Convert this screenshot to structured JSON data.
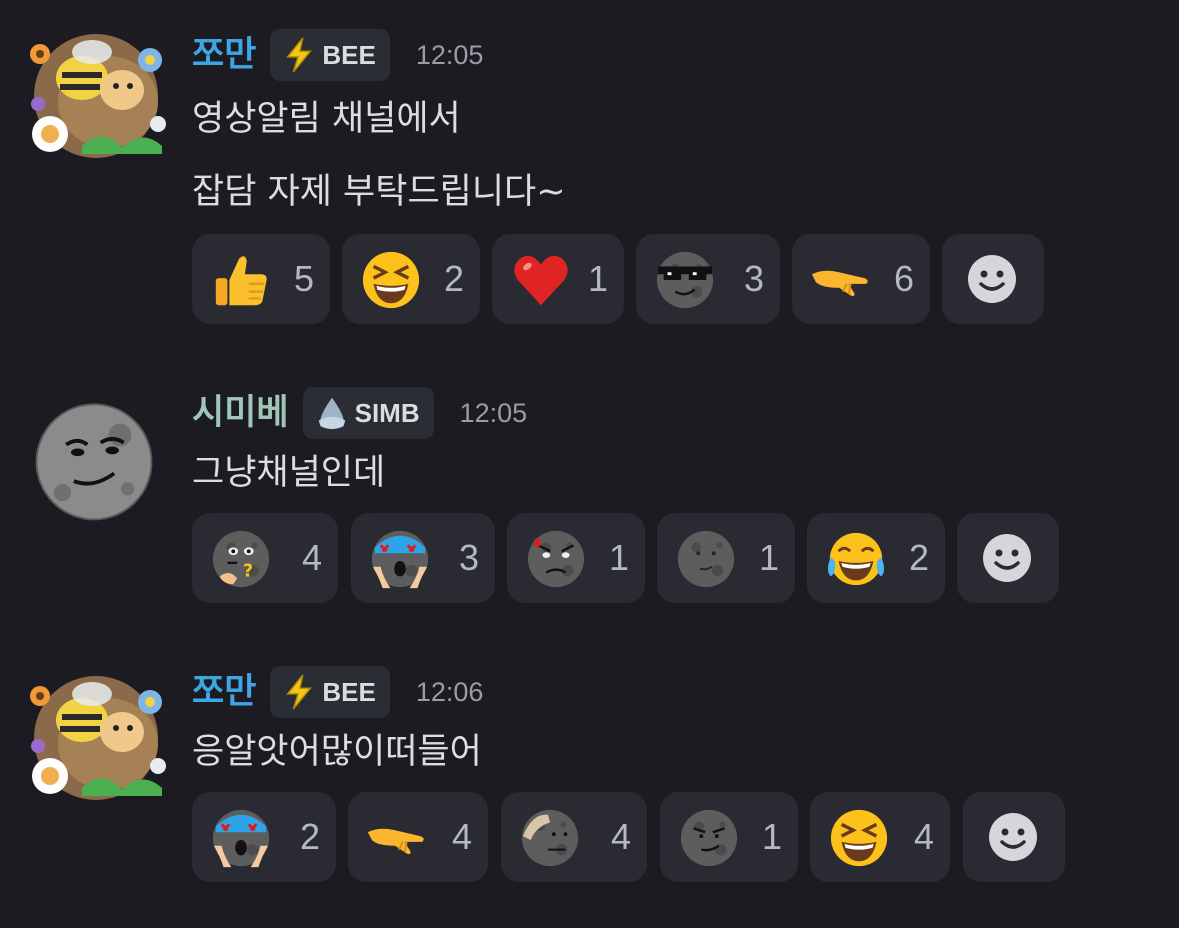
{
  "messages": [
    {
      "author": "쪼만",
      "author_color": "#3ea6e6",
      "badge": {
        "icon": "lightning-bolt-icon",
        "label": "BEE"
      },
      "time": "12:05",
      "lines": [
        "영상알림 채널에서",
        "잡담 자제 부탁드립니다~"
      ],
      "reactions": [
        {
          "emoji": "thumbs-up-icon",
          "count": "5"
        },
        {
          "emoji": "grinning-squinting-face-icon",
          "count": "2"
        },
        {
          "emoji": "red-heart-icon",
          "count": "1"
        },
        {
          "emoji": "cool-moon-face-sunglasses-icon",
          "count": "3"
        },
        {
          "emoji": "pointing-hand-icon",
          "count": "6"
        }
      ]
    },
    {
      "author": "시미베",
      "author_color": "#9fc7b7",
      "badge": {
        "icon": "water-drop-icon",
        "label": "SIMB"
      },
      "time": "12:05",
      "lines": [
        "그냥채널인데"
      ],
      "reactions": [
        {
          "emoji": "thinking-moon-face-icon",
          "count": "4"
        },
        {
          "emoji": "shocked-moon-face-icon",
          "count": "3"
        },
        {
          "emoji": "angry-moon-face-icon",
          "count": "1"
        },
        {
          "emoji": "moon-face-icon",
          "count": "1"
        },
        {
          "emoji": "face-with-tears-of-joy-icon",
          "count": "2"
        }
      ]
    },
    {
      "author": "쪼만",
      "author_color": "#3ea6e6",
      "badge": {
        "icon": "lightning-bolt-icon",
        "label": "BEE"
      },
      "time": "12:06",
      "lines": [
        "응알앗어많이떠들어"
      ],
      "reactions": [
        {
          "emoji": "shocked-moon-face-icon",
          "count": "2"
        },
        {
          "emoji": "pointing-hand-icon",
          "count": "4"
        },
        {
          "emoji": "salute-moon-face-icon",
          "count": "4"
        },
        {
          "emoji": "smirk-moon-face-icon",
          "count": "1"
        },
        {
          "emoji": "grinning-squinting-face-icon",
          "count": "4"
        }
      ]
    }
  ],
  "add_reaction": {
    "icon": "add-reaction-smiley-icon"
  }
}
